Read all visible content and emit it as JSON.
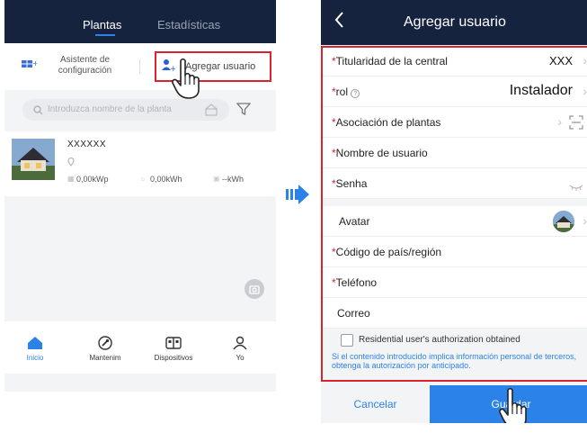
{
  "left_screen": {
    "tabs": [
      {
        "label": "Plantas"
      },
      {
        "label": "Estadísticas"
      }
    ],
    "actions": {
      "setup_wizard_label": "Asistente de configuración",
      "add_user_label": "Agregar usuario"
    },
    "search": {
      "placeholder": "Introduzca nombre de la planta"
    },
    "plant": {
      "name": "XXXXXX",
      "capacity": "0,00kWp",
      "energy": "0,00kWh",
      "power": "--kWh"
    },
    "bottom_nav": [
      {
        "label": "Inicio"
      },
      {
        "label": "Mantenim"
      },
      {
        "label": "Dispositivos"
      },
      {
        "label": "Yo"
      }
    ]
  },
  "right_screen": {
    "title": "Agregar usuario",
    "fields": {
      "ownership_label": "Titularidad de la central",
      "ownership_value": "XXX",
      "role_label": "rol",
      "role_value": "Instalador",
      "plant_assoc_label": "Asociación de plantas",
      "username_label": "Nombre de usuario",
      "password_label": "Senha",
      "avatar_label": "Avatar",
      "country_code_label": "Código de país/región",
      "phone_label": "Teléfono",
      "email_label": "Correo"
    },
    "authorization": {
      "checkbox_label": "Residential user's authorization obtained",
      "notice": "Si el contenido introducido implica información personal de terceros, obtenga la autorización por anticipado."
    },
    "buttons": {
      "cancel": "Cancelar",
      "save": "Guardar"
    }
  },
  "colors": {
    "header": "#16233f",
    "accent_blue": "#2b82e8",
    "highlight_red": "#d9232e"
  }
}
